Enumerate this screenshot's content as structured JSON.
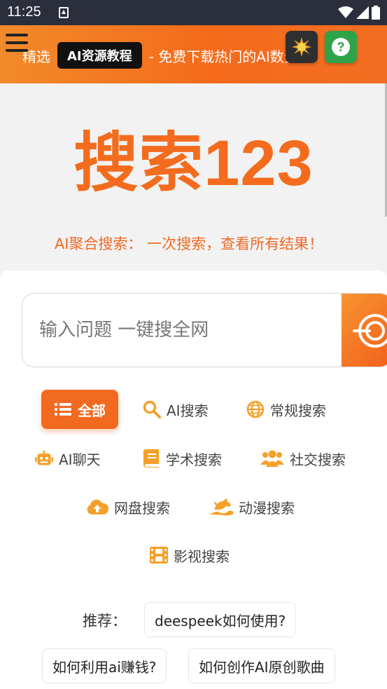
{
  "status_bar": {
    "time": "11:25"
  },
  "banner": {
    "prefix": "精选",
    "tag": "AI资源教程",
    "suffix": "- 免费下载热门的AI数资源!"
  },
  "hero": {
    "logo": "搜索123",
    "subtitle": "AI聚合搜索： 一次搜索，查看所有结果！"
  },
  "search": {
    "placeholder": "输入问题 一键搜全网"
  },
  "categories": [
    {
      "label": "全部",
      "icon": "list-icon",
      "active": true
    },
    {
      "label": "AI搜索",
      "icon": "search-icon",
      "active": false
    },
    {
      "label": "常规搜索",
      "icon": "globe-icon",
      "active": false
    },
    {
      "label": "AI聊天",
      "icon": "robot-icon",
      "active": false
    },
    {
      "label": "学术搜索",
      "icon": "book-icon",
      "active": false
    },
    {
      "label": "社交搜索",
      "icon": "users-icon",
      "active": false
    },
    {
      "label": "网盘搜索",
      "icon": "cloud-upload-icon",
      "active": false
    },
    {
      "label": "动漫搜索",
      "icon": "dragon-icon",
      "active": false
    },
    {
      "label": "影视搜索",
      "icon": "film-icon",
      "active": false
    }
  ],
  "recommend": {
    "label": "推荐：",
    "items": [
      "deespeek如何使用?",
      "如何利用ai赚钱?",
      "如何创作AI原创歌曲"
    ]
  },
  "colors": {
    "accent": "#f26a1f",
    "icon_orange": "#f5a02a"
  }
}
